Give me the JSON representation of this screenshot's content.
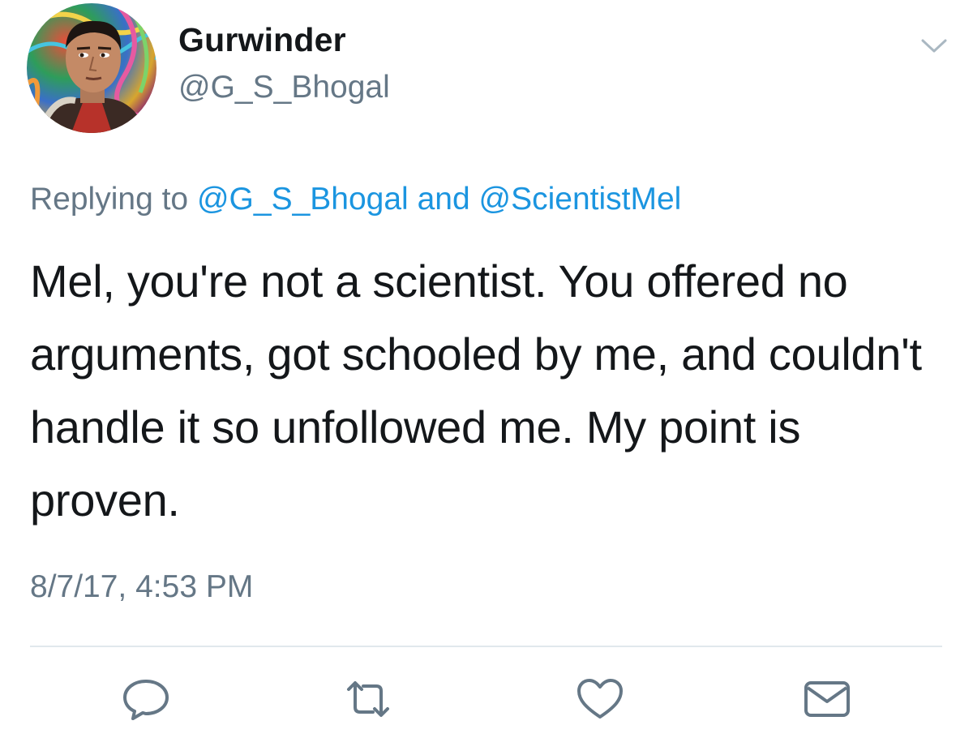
{
  "user": {
    "display_name": "Gurwinder",
    "handle": "@G_S_Bhogal",
    "avatar_icon": "profile-photo"
  },
  "reply": {
    "prefix": "Replying to",
    "mention_1": "@G_S_Bhogal",
    "conjunction": "and",
    "mention_2": "@ScientistMel"
  },
  "tweet": {
    "text": "Mel, you're not a scientist. You offered no arguments, got schooled by me, and couldn't handle it so unfollowed me. My point is proven.",
    "timestamp": "8/7/17, 4:53 PM"
  },
  "actions": [
    {
      "name": "reply",
      "icon": "speech-bubble-icon"
    },
    {
      "name": "retweet",
      "icon": "retweet-icon"
    },
    {
      "name": "like",
      "icon": "heart-icon"
    },
    {
      "name": "direct-message",
      "icon": "envelope-icon"
    }
  ],
  "colors": {
    "text": "#14171a",
    "secondary": "#657786",
    "link": "#1b95e0",
    "divider": "#e1e8ed"
  }
}
